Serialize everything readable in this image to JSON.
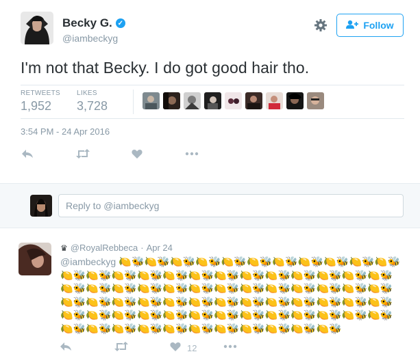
{
  "author": {
    "name": "Becky G.",
    "handle": "@iambeckyg",
    "verified_mark": "✓"
  },
  "follow_button": {
    "label": "Follow",
    "icon": "add-user-icon"
  },
  "settings_icon": "gear-icon",
  "tweet": {
    "text": "I'm not that Becky. I do got good hair tho.",
    "timestamp": "3:54 PM - 24 Apr 2016"
  },
  "stats": {
    "retweets_label": "RETWEETS",
    "retweets_value": "1,952",
    "likes_label": "LIKES",
    "likes_value": "3,728"
  },
  "reply_box": {
    "placeholder": "Reply to @iambeckyg"
  },
  "reply": {
    "crown": "♛",
    "handle": "@RoyalRebbeca",
    "separator": "·",
    "date": "Apr 24",
    "mention": "@iambeckyg",
    "likes_count": "12",
    "emojis": "🍋🐝🍋🐝🍋🐝🍋🐝🍋🐝🍋🐝🍋🐝🍋🐝🍋🐝🍋🐝🍋🐝🍋🐝🍋🐝🍋🐝🍋🐝🍋🐝🍋🐝🍋🐝🍋🐝🍋🐝🍋🐝🍋🐝🍋🐝🍋🐝🍋🐝🍋🐝🍋🐝🍋🐝🍋🐝🍋🐝🍋🐝🍋🐝🍋🐝🍋🐝🍋🐝🍋🐝🍋🐝🍋🐝🍋🐝🍋🐝🍋🐝🍋🐝🍋🐝🍋🐝🍋🐝🍋🐝🍋🐝🍋🐝🍋🐝🍋🐝🍋🐝🍋🐝🍋🐝🍋🐝🍋🐝🍋🐝🍋🐝🍋🐝🍋🐝🍋🐝🍋🐝🍋🐝🍋🐝🍋🐝🍋🐝🍋🐝🍋🐝🍋🐝🍋🐝🍋🐝🍋🐝🍋🐝🍋🐝🍋🐝"
  },
  "colors": {
    "accent": "#1da1f2",
    "muted": "#8899a6",
    "text": "#292f33",
    "border": "#e1e8ed"
  }
}
